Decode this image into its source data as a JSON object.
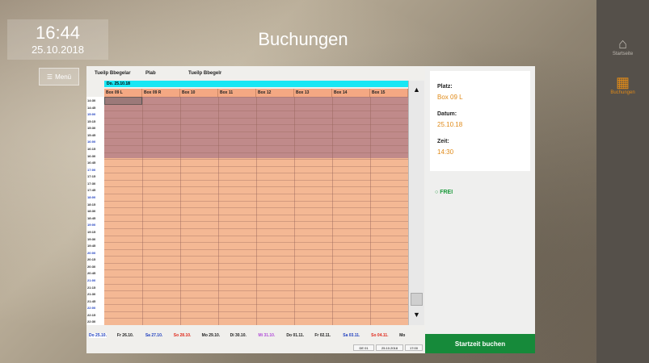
{
  "header": {
    "time": "16:44",
    "date": "25.10.2018",
    "title": "Buchungen",
    "menu_label": "Menü"
  },
  "nav": [
    {
      "label": "Startseite",
      "icon": "home-icon",
      "active": false
    },
    {
      "label": "Buchungen",
      "icon": "calendar-icon",
      "active": true
    }
  ],
  "toolbar": {
    "field1": "Tueilp Bbegelar",
    "field2": "Plab",
    "field3": "Tueilp Bbegelr"
  },
  "grid": {
    "day_header": "Do. 25.10.18",
    "columns": [
      "Box 09 L",
      "Box 09 R",
      "Box 10",
      "Box 11",
      "Box 12",
      "Box 13",
      "Box 14",
      "Box 15"
    ],
    "times": [
      "14:30",
      "14:45",
      "15:00",
      "15:15",
      "15:30",
      "15:45",
      "16:00",
      "16:15",
      "16:30",
      "16:45",
      "17:00",
      "17:15",
      "17:30",
      "17:45",
      "18:00",
      "18:15",
      "18:30",
      "18:45",
      "19:00",
      "19:15",
      "19:30",
      "19:45",
      "20:00",
      "20:15",
      "20:30",
      "20:45",
      "21:00",
      "21:15",
      "21:30",
      "21:45",
      "22:00",
      "22:15",
      "22:30"
    ],
    "booked_until_row": 8
  },
  "dates": [
    {
      "label": "Do 25.10.",
      "color": "#1f3fbf"
    },
    {
      "label": "Fr 26.10.",
      "color": "#222222"
    },
    {
      "label": "Sa 27.10.",
      "color": "#1f3fbf"
    },
    {
      "label": "So 28.10.",
      "color": "#e0281a"
    },
    {
      "label": "Mo 29.10.",
      "color": "#222222"
    },
    {
      "label": "Di 30.10.",
      "color": "#222222"
    },
    {
      "label": "Mi 31.10.",
      "color": "#b04ad8"
    },
    {
      "label": "Do 01.11.",
      "color": "#222222"
    },
    {
      "label": "Fr 02.11.",
      "color": "#222222"
    },
    {
      "label": "Sa 03.11.",
      "color": "#1f3fbf"
    },
    {
      "label": "So 04.11.",
      "color": "#e0281a"
    },
    {
      "label": "Mo",
      "color": "#222222"
    }
  ],
  "statusbar": {
    "a": "DE 01",
    "b": "25.10.2018",
    "c": "17:00"
  },
  "side": {
    "platz_label": "Platz:",
    "platz_value": "Box 09 L",
    "datum_label": "Datum:",
    "datum_value": "25.10.18",
    "zeit_label": "Zeit:",
    "zeit_value": "14:30",
    "status": "FREI",
    "book_button": "Startzeit buchen"
  },
  "colors": {
    "accent": "#e08a18",
    "book": "#168a3a",
    "booked": "#c08a8a",
    "free": "#f4b894",
    "cyan": "#18e7f4"
  }
}
